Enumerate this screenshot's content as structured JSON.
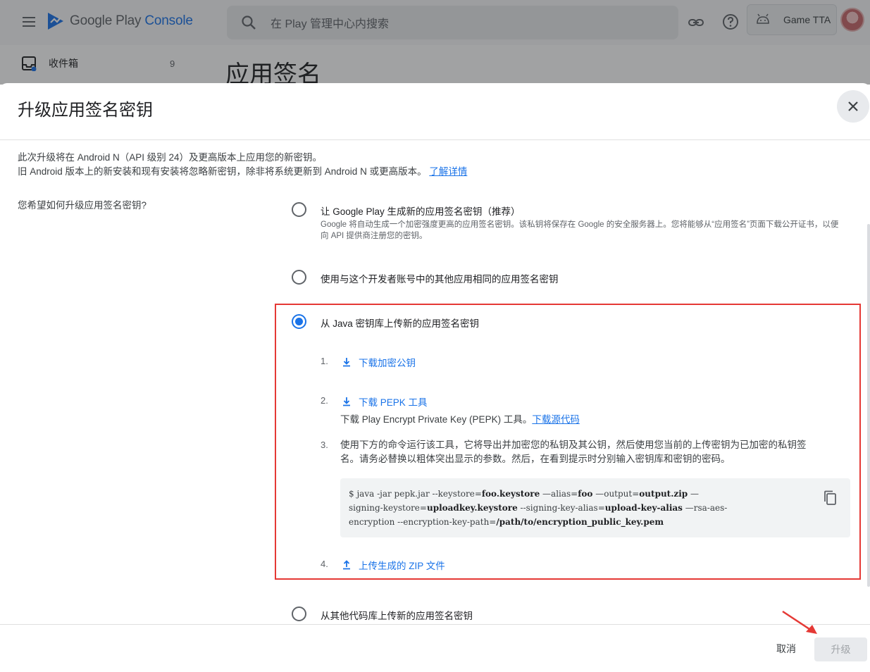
{
  "app": {
    "logo_text_main": "Google Play",
    "logo_text_accent": "Console",
    "search_placeholder": "在 Play 管理中心内搜索",
    "account_name": "Game TTA"
  },
  "sidebar": {
    "inbox_label": "收件箱",
    "inbox_count": "9"
  },
  "page": {
    "title": "应用签名"
  },
  "dialog": {
    "title": "升级应用签名密钥",
    "intro_line1": "此次升级将在 Android N（API 级别 24）及更高版本上应用您的新密钥。",
    "intro_line2": "旧 Android 版本上的新安装和现有安装将忽略新密钥，除非将系统更新到 Android N 或更高版本。",
    "learn_more": "了解详情",
    "question": "您希望如何升级应用签名密钥?",
    "options": [
      {
        "label": "让 Google Play 生成新的应用签名密钥（推荐）",
        "description": "Google 将自动生成一个加密强度更高的应用签名密钥。该私钥将保存在 Google 的安全服务器上。您将能够从“应用签名”页面下载公开证书，以便向 API 提供商注册您的密钥。",
        "selected": false
      },
      {
        "label": "使用与这个开发者账号中的其他应用相同的应用签名密钥",
        "selected": false
      },
      {
        "label": "从 Java 密钥库上传新的应用签名密钥",
        "selected": true
      },
      {
        "label": "从其他代码库上传新的应用签名密钥",
        "selected": false
      }
    ],
    "steps": {
      "s1_num": "1.",
      "s1_link": "下载加密公钥",
      "s2_num": "2.",
      "s2_link": "下载 PEPK 工具",
      "s2_text": "下载 Play Encrypt Private Key (PEPK) 工具。",
      "s2_source_link": "下载源代码",
      "s3_num": "3.",
      "s3_text_line1": "使用下方的命令运行该工具，它将导出并加密您的私钥及其公钥，然后使用您当前的上传密钥为已加密的私钥签",
      "s3_text_line2": "名。请务必替换以粗体突出显示的参数。然后，在看到提示时分别输入密钥库和密钥的密码。",
      "s4_num": "4.",
      "s4_link": "上传生成的 ZIP 文件"
    },
    "code": {
      "c1": "$ java -jar pepk.jar --keystore=",
      "b1": "foo.keystore",
      "c2": " —alias=",
      "b2": "foo",
      "c3": " —output=",
      "b3": "output.zip",
      "c4": "  —",
      "c5": "signing-keystore=",
      "b5": "uploadkey.keystore",
      "c6": " --signing-key-alias=",
      "b6": "upload-key-alias",
      "c7": " —rsa-aes-",
      "c8": "encryption --encryption-key-path=",
      "b8": "/path/to/encryption_public_key.pem"
    },
    "footer": {
      "cancel": "取消",
      "upgrade": "升级"
    }
  },
  "colors": {
    "accent": "#1a73e8",
    "highlight_box": "#e53935",
    "annotation_arrow": "#e53935"
  }
}
